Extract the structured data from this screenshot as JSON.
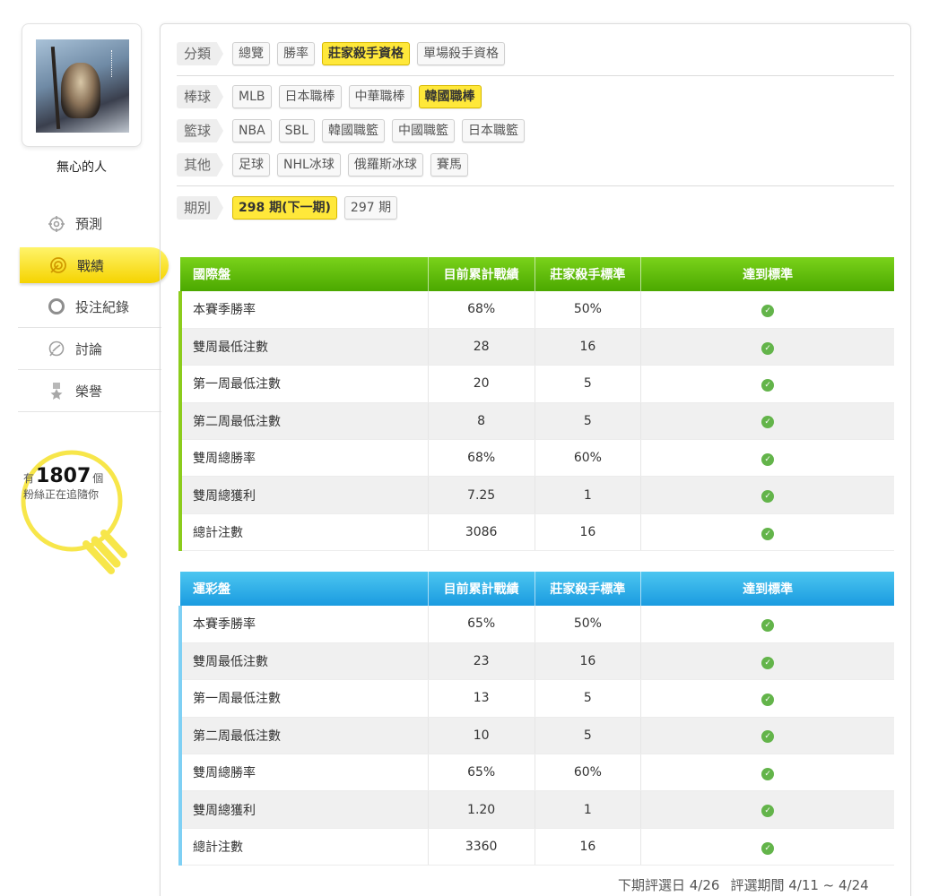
{
  "user": {
    "name": "無心的人"
  },
  "nav": [
    {
      "label": "預測",
      "icon": "crosshair-icon"
    },
    {
      "label": "戰績",
      "icon": "target-icon",
      "active": true
    },
    {
      "label": "投注紀錄",
      "icon": "circle-icon"
    },
    {
      "label": "討論",
      "icon": "chat-icon"
    },
    {
      "label": "榮譽",
      "icon": "medal-icon"
    }
  ],
  "fans": {
    "prefix": "有",
    "count": "1807",
    "unit": "個",
    "line2": "粉絲正在追隨你"
  },
  "filters": {
    "category": {
      "label": "分類",
      "options": [
        "總覽",
        "勝率",
        "莊家殺手資格",
        "單場殺手資格"
      ],
      "selected": "莊家殺手資格"
    },
    "baseball": {
      "label": "棒球",
      "options": [
        "MLB",
        "日本職棒",
        "中華職棒",
        "韓國職棒"
      ],
      "selected": "韓國職棒"
    },
    "basketball": {
      "label": "籃球",
      "options": [
        "NBA",
        "SBL",
        "韓國職籃",
        "中國職籃",
        "日本職籃"
      ]
    },
    "other": {
      "label": "其他",
      "options": [
        "足球",
        "NHL冰球",
        "俄羅斯冰球",
        "賽馬"
      ]
    },
    "period": {
      "label": "期別",
      "options": [
        "298 期(下一期)",
        "297 期"
      ],
      "selected": "298 期(下一期)"
    }
  },
  "table_intl": {
    "headers": [
      "國際盤",
      "目前累計戰績",
      "莊家殺手標準",
      "達到標準"
    ],
    "rows": [
      [
        "本賽季勝率",
        "68%",
        "50%"
      ],
      [
        "雙周最低注數",
        "28",
        "16"
      ],
      [
        "第一周最低注數",
        "20",
        "5"
      ],
      [
        "第二周最低注數",
        "8",
        "5"
      ],
      [
        "雙周總勝率",
        "68%",
        "60%"
      ],
      [
        "雙周總獲利",
        "7.25",
        "1"
      ],
      [
        "總計注數",
        "3086",
        "16"
      ]
    ]
  },
  "table_lottery": {
    "headers": [
      "運彩盤",
      "目前累計戰績",
      "莊家殺手標準",
      "達到標準"
    ],
    "rows": [
      [
        "本賽季勝率",
        "65%",
        "50%"
      ],
      [
        "雙周最低注數",
        "23",
        "16"
      ],
      [
        "第一周最低注數",
        "13",
        "5"
      ],
      [
        "第二周最低注數",
        "10",
        "5"
      ],
      [
        "雙周總勝率",
        "65%",
        "60%"
      ],
      [
        "雙周總獲利",
        "1.20",
        "1"
      ],
      [
        "總計注數",
        "3360",
        "16"
      ]
    ]
  },
  "footer": {
    "next_date": "下期評選日 4/26",
    "period": "評選期間 4/11 ~ 4/24"
  },
  "colors": {
    "accent_yellow": "#ffe83a",
    "green_header": "#4ba800",
    "blue_header": "#1a9be0",
    "check_green": "#63b44a"
  }
}
